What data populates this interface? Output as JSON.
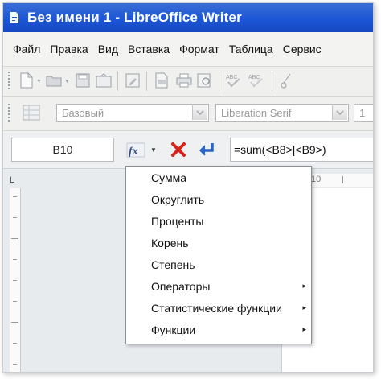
{
  "window": {
    "title": "Без имени 1 - LibreOffice Writer"
  },
  "menubar": {
    "items": [
      "Файл",
      "Правка",
      "Вид",
      "Вставка",
      "Формат",
      "Таблица",
      "Сервис"
    ]
  },
  "toolbar": {
    "style_value": "Базовый",
    "font_value": "Liberation Serif",
    "size_value": "1"
  },
  "formula_bar": {
    "cell_reference": "B10",
    "formula": "=sum(<B8>|<B9>)",
    "icons": [
      "formula-icon",
      "cancel-icon",
      "apply-icon"
    ],
    "accent_colors": {
      "cancel": "#d8231a",
      "apply": "#2a64c8"
    }
  },
  "ruler": {
    "corner_mark": "L",
    "h_label": "10"
  },
  "formula_menu": {
    "items": [
      {
        "label": "Сумма",
        "submenu": false
      },
      {
        "label": "Округлить",
        "submenu": false
      },
      {
        "label": "Проценты",
        "submenu": false
      },
      {
        "label": "Корень",
        "submenu": false
      },
      {
        "label": "Степень",
        "submenu": false
      },
      {
        "label": "Операторы",
        "submenu": true
      },
      {
        "label": "Статистические функции",
        "submenu": true
      },
      {
        "label": "Функции",
        "submenu": true
      }
    ],
    "submenu_glyph": "▸"
  },
  "colors": {
    "title_bar": "#1c56d6",
    "menu_bg": "#f3f3f1"
  }
}
